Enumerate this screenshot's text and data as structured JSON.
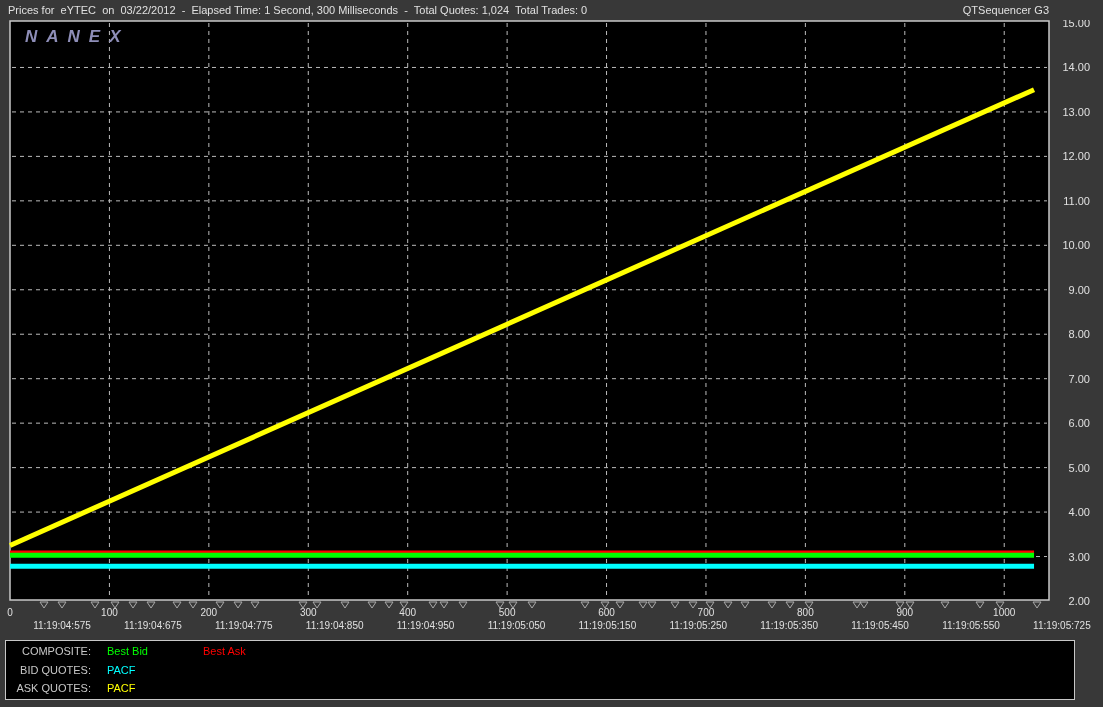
{
  "header": {
    "title": "Prices for  eYTEC  on  03/22/2012  -  Elapsed Time: 1 Second, 300 Milliseconds  -  Total Quotes: 1,024  Total Trades: 0",
    "app_name": "QTSequencer G3"
  },
  "chart": {
    "logo": "NANEX",
    "time_labels": [
      "11:19:04:575",
      "11:19:04:675",
      "11:19:04:775",
      "11:19:04:850",
      "11:19:04:950",
      "11:19:05:050",
      "11:19:05:150",
      "11:19:05:250",
      "11:19:05:350",
      "11:19:05:450",
      "11:19:05:550",
      "11:19:05:725"
    ],
    "chart_data": {
      "type": "line",
      "x": [
        0,
        1030
      ],
      "xlim": [
        0,
        1038
      ],
      "ylim": [
        2,
        15
      ],
      "grid": true,
      "xticks": [
        0,
        100,
        200,
        300,
        400,
        500,
        600,
        700,
        800,
        900,
        1000
      ],
      "yticks": [
        {
          "value": 2,
          "label": "2.00"
        },
        {
          "value": 3,
          "label": "3.00"
        },
        {
          "value": 4,
          "label": "4.00"
        },
        {
          "value": 5,
          "label": "5.00"
        },
        {
          "value": 6,
          "label": "6.00"
        },
        {
          "value": 7,
          "label": "7.00"
        },
        {
          "value": 8,
          "label": "8.00"
        },
        {
          "value": 9,
          "label": "9.00"
        },
        {
          "value": 10,
          "label": "10.00"
        },
        {
          "value": 11,
          "label": "11.00"
        },
        {
          "value": 12,
          "label": "12.00"
        },
        {
          "value": 13,
          "label": "13.00"
        },
        {
          "value": 14,
          "label": "14.00"
        },
        {
          "value": 15,
          "label": "15.00"
        }
      ],
      "series": [
        {
          "color": "#ffff00",
          "values": [
            3.25,
            13.5
          ]
        },
        {
          "color": "#ff0000",
          "values": [
            3.08,
            3.08
          ]
        },
        {
          "color": "#00ff00",
          "values": [
            3.03,
            3.03
          ]
        },
        {
          "color": "#00ffff",
          "values": [
            2.78,
            2.78
          ]
        }
      ]
    }
  },
  "legend": [
    {
      "label": "COMPOSITE:",
      "entries": [
        {
          "name": "Best Bid",
          "color": "#00ff00"
        },
        {
          "name": "Best Ask",
          "color": "#ff0000"
        }
      ]
    },
    {
      "label": "BID QUOTES:",
      "entries": [
        {
          "name": "PACF",
          "color": "#00ffff"
        }
      ]
    },
    {
      "label": "ASK QUOTES:",
      "entries": [
        {
          "name": "PACF",
          "color": "#ffff00"
        }
      ]
    }
  ]
}
